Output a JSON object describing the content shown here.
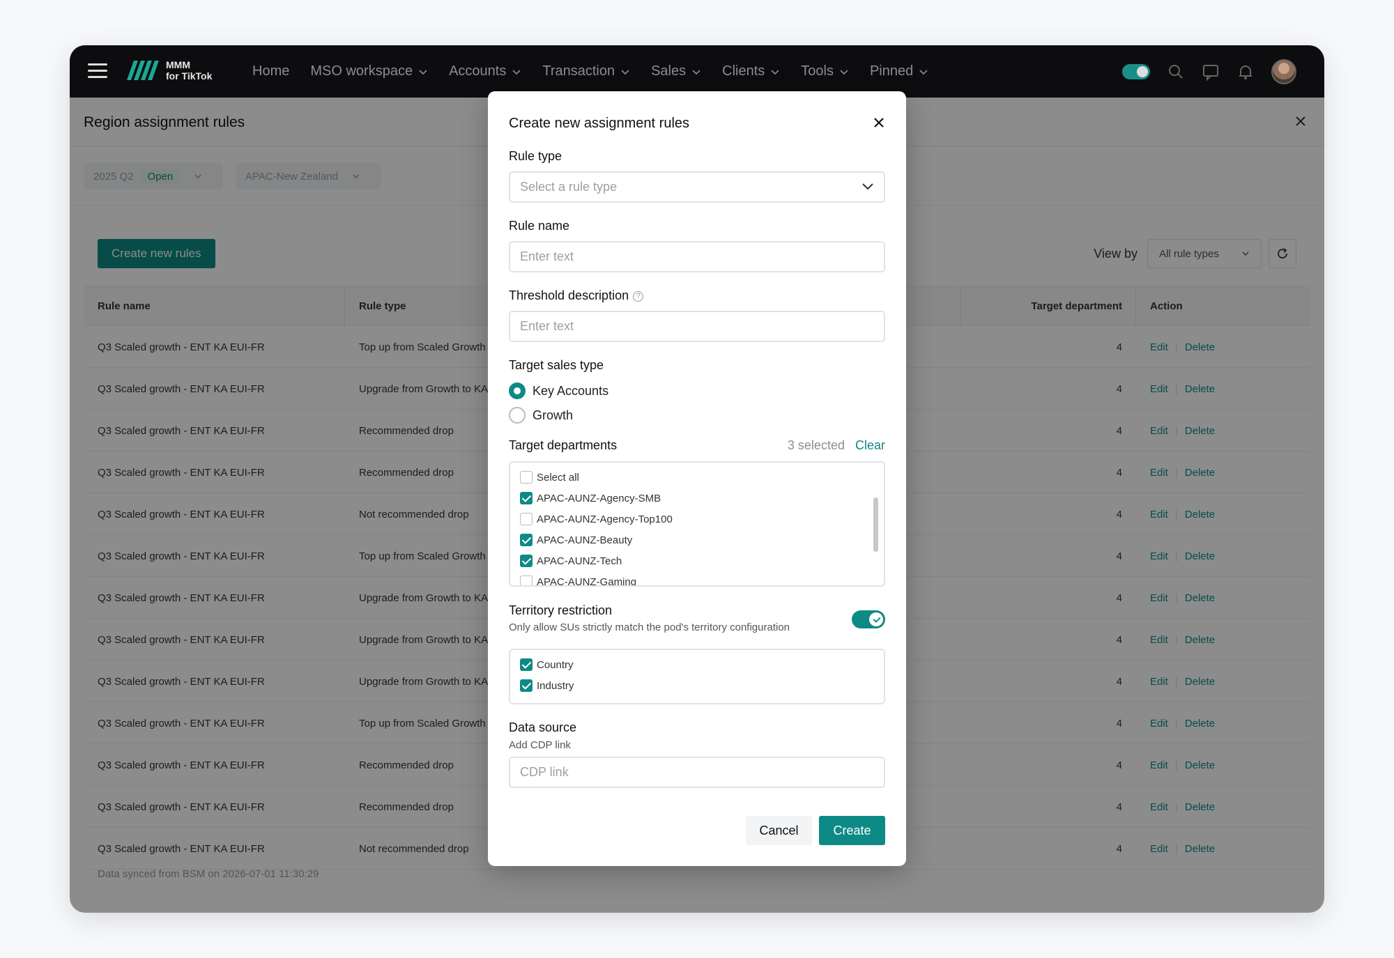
{
  "app": {
    "logo_line1": "MMM",
    "logo_line2": "for TikTok",
    "nav": [
      {
        "label": "Home",
        "has_chevron": false
      },
      {
        "label": "MSO workspace",
        "has_chevron": true
      },
      {
        "label": "Accounts",
        "has_chevron": true
      },
      {
        "label": "Transaction",
        "has_chevron": true
      },
      {
        "label": "Sales",
        "has_chevron": true
      },
      {
        "label": "Clients",
        "has_chevron": true
      },
      {
        "label": "Tools",
        "has_chevron": true
      },
      {
        "label": "Pinned",
        "has_chevron": true
      }
    ],
    "icons": [
      "hamburger-icon",
      "search-icon",
      "message-icon",
      "bell-icon"
    ]
  },
  "page": {
    "title": "Region assignment rules",
    "filters": {
      "quarter": "2025 Q2",
      "quarter_status": "Open",
      "region": "APAC-New Zealand"
    },
    "create_button": "Create new rules",
    "view_by_label": "View by",
    "view_by_value": "All rule types",
    "columns": {
      "rule_name": "Rule name",
      "rule_type": "Rule type",
      "target_department": "Target department",
      "action": "Action"
    },
    "rows": [
      {
        "name": "Q3 Scaled growth - ENT KA EUI-FR",
        "type": "Top up from Scaled Growth",
        "dept": "4"
      },
      {
        "name": "Q3 Scaled growth - ENT KA EUI-FR",
        "type": "Upgrade from Growth to KA",
        "dept": "4"
      },
      {
        "name": "Q3 Scaled growth - ENT KA EUI-FR",
        "type": "Recommended drop",
        "dept": "4"
      },
      {
        "name": "Q3 Scaled growth - ENT KA EUI-FR",
        "type": "Recommended drop",
        "dept": "4"
      },
      {
        "name": "Q3 Scaled growth - ENT KA EUI-FR",
        "type": "Not recommended drop",
        "dept": "4"
      },
      {
        "name": "Q3 Scaled growth - ENT KA EUI-FR",
        "type": "Top up from Scaled Growth",
        "dept": "4"
      },
      {
        "name": "Q3 Scaled growth - ENT KA EUI-FR",
        "type": "Upgrade from Growth to KA",
        "dept": "4"
      },
      {
        "name": "Q3 Scaled growth - ENT KA EUI-FR",
        "type": "Upgrade from Growth to KA",
        "dept": "4"
      },
      {
        "name": "Q3 Scaled growth - ENT KA EUI-FR",
        "type": "Upgrade from Growth to KA",
        "dept": "4"
      },
      {
        "name": "Q3 Scaled growth - ENT KA EUI-FR",
        "type": "Top up from Scaled Growth",
        "dept": "4"
      },
      {
        "name": "Q3 Scaled growth - ENT KA EUI-FR",
        "type": "Recommended drop",
        "dept": "4"
      },
      {
        "name": "Q3 Scaled growth - ENT KA EUI-FR",
        "type": "Recommended drop",
        "dept": "4"
      },
      {
        "name": "Q3 Scaled growth - ENT KA EUI-FR",
        "type": "Not recommended drop",
        "dept": "4"
      }
    ],
    "edit_label": "Edit",
    "delete_label": "Delete",
    "footer_note": "Data synced from BSM on 2026-07-01 11:30:29"
  },
  "modal": {
    "title": "Create new assignment rules",
    "rule_type_label": "Rule type",
    "rule_type_placeholder": "Select a rule type",
    "rule_name_label": "Rule name",
    "rule_name_placeholder": "Enter text",
    "threshold_label": "Threshold description",
    "threshold_placeholder": "Enter text",
    "target_sales_type_label": "Target sales type",
    "sales_types": [
      {
        "label": "Key Accounts",
        "selected": true
      },
      {
        "label": "Growth",
        "selected": false
      }
    ],
    "target_departments_label": "Target departments",
    "selected_count": "3 selected",
    "clear_label": "Clear",
    "departments": [
      {
        "label": "Select all",
        "checked": false
      },
      {
        "label": "APAC-AUNZ-Agency-SMB",
        "checked": true
      },
      {
        "label": "APAC-AUNZ-Agency-Top100",
        "checked": false
      },
      {
        "label": "APAC-AUNZ-Beauty",
        "checked": true
      },
      {
        "label": "APAC-AUNZ-Tech",
        "checked": true
      },
      {
        "label": "APAC-AUNZ-Gaming",
        "checked": false
      }
    ],
    "territory_label": "Territory restriction",
    "territory_desc": "Only allow SUs strictly match the pod's territory configuration",
    "territory_enabled": true,
    "territory_options": [
      {
        "label": "Country",
        "checked": true
      },
      {
        "label": "Industry",
        "checked": true
      }
    ],
    "data_source_label": "Data source",
    "data_source_sub": "Add CDP link",
    "data_source_placeholder": "CDP link",
    "cancel_label": "Cancel",
    "create_label": "Create"
  },
  "colors": {
    "accent": "#0d8a86",
    "nav_bg": "#0d0d0f",
    "overlay": "rgba(0,0,0,0.45)"
  }
}
